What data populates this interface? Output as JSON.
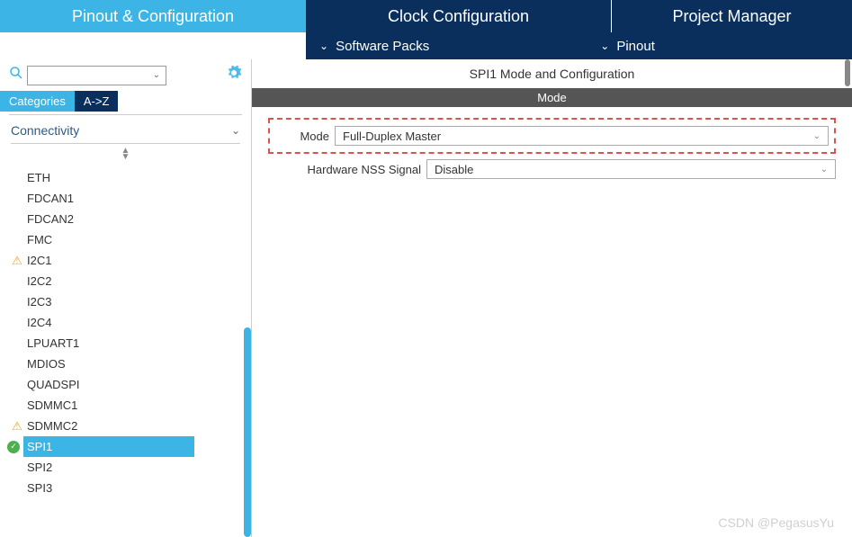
{
  "tabs": {
    "pinout": "Pinout & Configuration",
    "clock": "Clock Configuration",
    "project": "Project Manager"
  },
  "subbar": {
    "software": "Software Packs",
    "pinout": "Pinout"
  },
  "sidebar": {
    "filter_categories": "Categories",
    "filter_az": "A->Z",
    "category": "Connectivity",
    "items": [
      {
        "label": "ETH",
        "icon": ""
      },
      {
        "label": "FDCAN1",
        "icon": ""
      },
      {
        "label": "FDCAN2",
        "icon": ""
      },
      {
        "label": "FMC",
        "icon": ""
      },
      {
        "label": "I2C1",
        "icon": "warn"
      },
      {
        "label": "I2C2",
        "icon": ""
      },
      {
        "label": "I2C3",
        "icon": ""
      },
      {
        "label": "I2C4",
        "icon": ""
      },
      {
        "label": "LPUART1",
        "icon": ""
      },
      {
        "label": "MDIOS",
        "icon": ""
      },
      {
        "label": "QUADSPI",
        "icon": ""
      },
      {
        "label": "SDMMC1",
        "icon": ""
      },
      {
        "label": "SDMMC2",
        "icon": "warn"
      },
      {
        "label": "SPI1",
        "icon": "check",
        "selected": true
      },
      {
        "label": "SPI2",
        "icon": ""
      },
      {
        "label": "SPI3",
        "icon": ""
      }
    ]
  },
  "panel": {
    "title": "SPI1 Mode and Configuration",
    "mode_header": "Mode",
    "mode_label": "Mode",
    "mode_value": "Full-Duplex Master",
    "nss_label": "Hardware NSS Signal",
    "nss_value": "Disable"
  },
  "watermark": "CSDN @PegasusYu"
}
